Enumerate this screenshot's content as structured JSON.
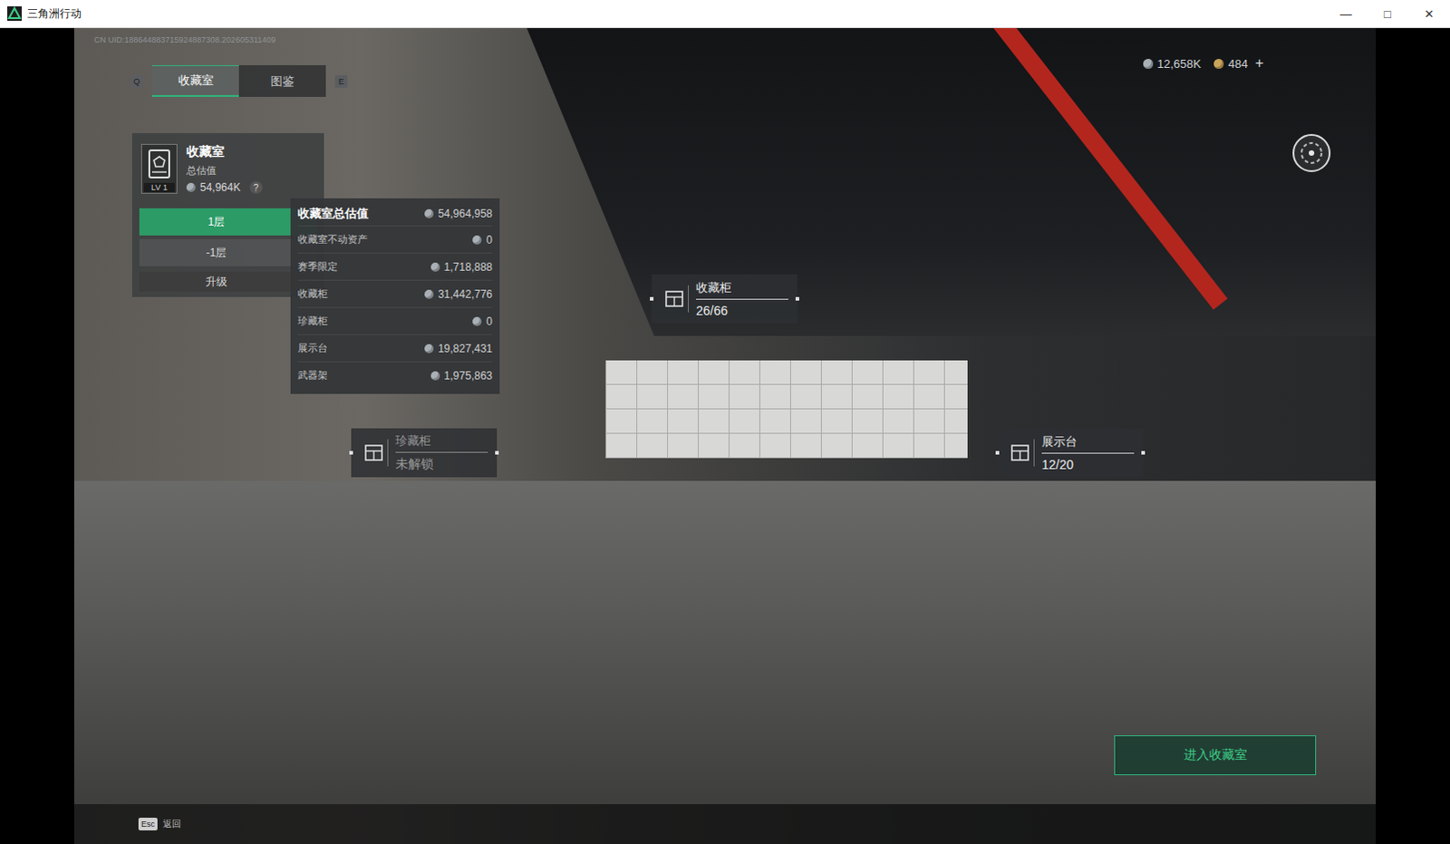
{
  "window": {
    "title": "三角洲行动",
    "controls": [
      "—",
      "□",
      "✕"
    ]
  },
  "uid": "CN UID:188644883715924887308.202605311409",
  "tabs": {
    "prev_key": "Q",
    "next_key": "E",
    "items": [
      {
        "label": "收藏室",
        "selected": true
      },
      {
        "label": "图鉴",
        "selected": false
      }
    ]
  },
  "currency": {
    "items": [
      {
        "value": "12,658K",
        "color": "#a9b0b6"
      },
      {
        "value": "484",
        "color": "#c9a45a"
      }
    ],
    "add": "+"
  },
  "room_panel": {
    "title": "收藏室",
    "subtitle": "总估值",
    "level": "LV 1",
    "value": "54,964K",
    "help": "?",
    "floors": [
      {
        "label": "1层",
        "selected": true
      },
      {
        "label": "-1层",
        "selected": false
      }
    ],
    "upgrade": "升级"
  },
  "tooltip": {
    "title": "收藏室总估值",
    "total": "54,964,958",
    "rows": [
      {
        "label": "收藏室不动资产",
        "value": "0"
      },
      {
        "label": "赛季限定",
        "value": "1,718,888"
      },
      {
        "label": "收藏柜",
        "value": "31,442,776"
      },
      {
        "label": "珍藏柜",
        "value": "0"
      },
      {
        "label": "展示台",
        "value": "19,827,431"
      },
      {
        "label": "武器架",
        "value": "1,975,863"
      }
    ]
  },
  "markers": [
    {
      "name": "收藏柜",
      "status": "26/66",
      "locked": false
    },
    {
      "name": "珍藏柜",
      "status": "未解锁",
      "locked": true
    },
    {
      "name": "展示台",
      "status": "12/20",
      "locked": false
    }
  ],
  "enter_button": "进入收藏室",
  "footer": {
    "key": "Esc",
    "label": "返回"
  }
}
